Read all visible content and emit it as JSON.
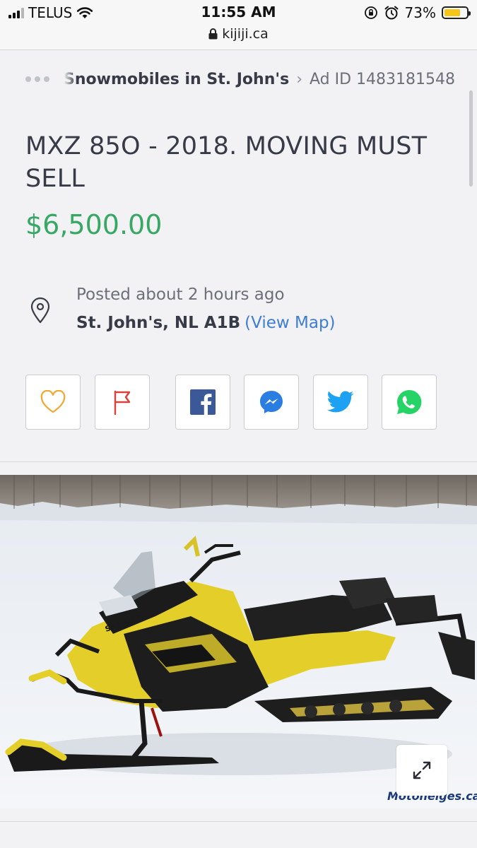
{
  "status_bar": {
    "carrier": "TELUS",
    "time": "11:55 AM",
    "battery_percent": "73%",
    "battery_level": 0.73,
    "url": "kijiji.ca"
  },
  "breadcrumb": {
    "category": "Snowmobiles in St. John's",
    "separator": "›",
    "ad_id": "Ad ID 1483181548"
  },
  "listing": {
    "title": "MXZ 85O - 2018. MOVING MUST SELL",
    "price": "$6,500.00",
    "posted": "Posted about 2 hours ago",
    "location": "St. John's, NL A1B",
    "view_map": "(View Map)"
  },
  "actions": [
    {
      "name": "favourite",
      "icon": "heart-icon",
      "color": "#f0a830"
    },
    {
      "name": "report",
      "icon": "flag-icon",
      "color": "#d9413a"
    },
    {
      "name": "share-facebook",
      "icon": "facebook-icon",
      "color": "#3b5998"
    },
    {
      "name": "share-messenger",
      "icon": "messenger-icon",
      "color": "#2a7de1"
    },
    {
      "name": "share-twitter",
      "icon": "twitter-icon",
      "color": "#1da1f2"
    },
    {
      "name": "share-whatsapp",
      "icon": "whatsapp-icon",
      "color": "#25d366"
    }
  ],
  "photo": {
    "watermark": "Motoneiges.ca",
    "expand_icon": "expand-icon"
  },
  "colors": {
    "price_green": "#37a864",
    "link_blue": "#3e7dd4",
    "text_dark": "#373a47",
    "text_muted": "#6c6e7a",
    "page_bg": "#f2f2f4"
  }
}
